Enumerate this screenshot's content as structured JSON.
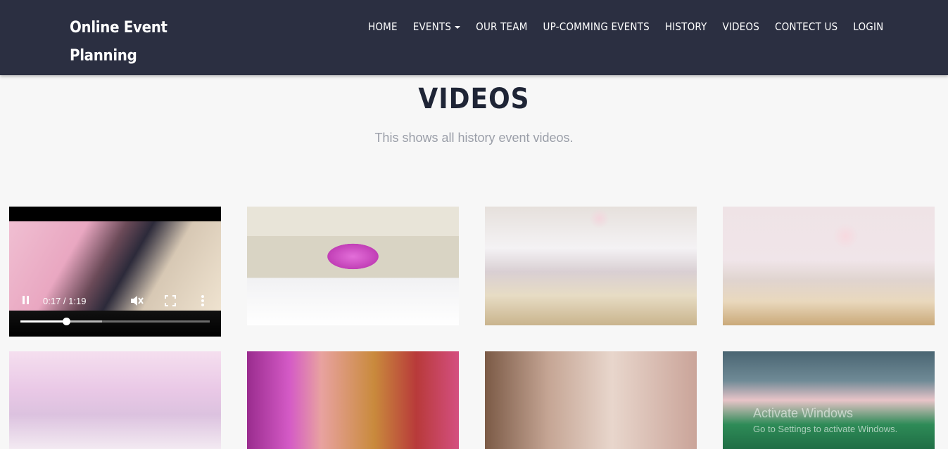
{
  "brand": {
    "line1": "Online Event",
    "line2": "Planning"
  },
  "nav": {
    "home": "HOME",
    "events": "EVENTS",
    "team": "OUR TEAM",
    "upcoming": "UP-COMMING EVENTS",
    "history": "HISTORY",
    "videos": "VIDEOS",
    "contact": "CONTECT US",
    "login": "LOGIN"
  },
  "page": {
    "title": "VIDEOS",
    "subtitle": "This shows all history event videos."
  },
  "player": {
    "time": "0:17 / 1:19",
    "progress_played": 0.24,
    "progress_buffered": 0.43,
    "icons": [
      "pause-icon",
      "muted-icon",
      "fullscreen-icon",
      "more-options-icon"
    ]
  },
  "thumbnails": [
    {
      "id": "stage",
      "desc_icon": "video-thumbnail"
    },
    {
      "id": "hall-1",
      "desc_icon": "video-thumbnail"
    },
    {
      "id": "hall-2",
      "desc_icon": "video-thumbnail"
    },
    {
      "id": "table-decor",
      "desc_icon": "video-thumbnail"
    },
    {
      "id": "cake",
      "desc_icon": "video-thumbnail"
    },
    {
      "id": "trees",
      "desc_icon": "video-thumbnail"
    },
    {
      "id": "garden",
      "desc_icon": "video-thumbnail"
    }
  ],
  "watermark": {
    "line1": "Activate Windows",
    "line2": "Go to Settings to activate Windows."
  }
}
